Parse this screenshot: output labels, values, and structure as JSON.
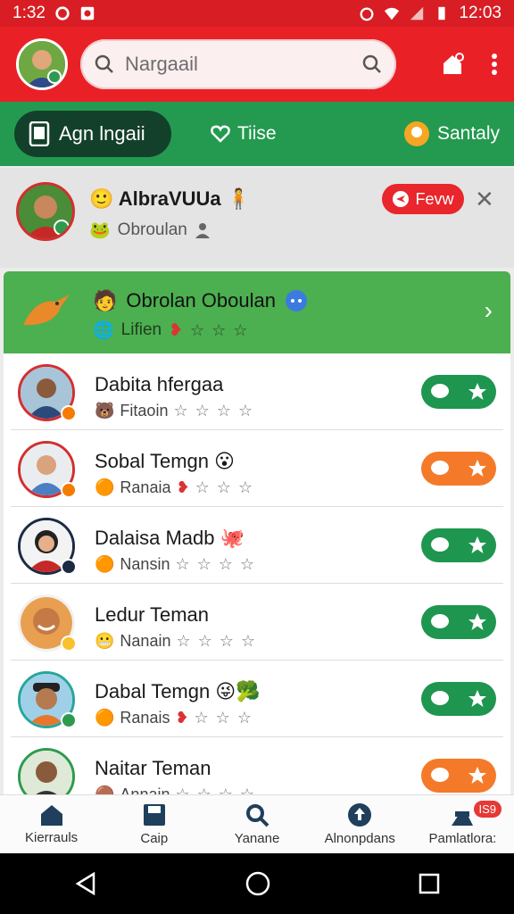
{
  "status_bar": {
    "time_left": "1:32",
    "time_right": "12:03"
  },
  "search": {
    "placeholder": "Nargaail"
  },
  "tabs": [
    {
      "label": "Agn lngaii"
    },
    {
      "label": "Tiise"
    },
    {
      "label": "Santaly"
    }
  ],
  "featured": {
    "name": "AlbraVUUa",
    "sub": "Obroulan",
    "button": "Fevw"
  },
  "highlight": {
    "title": "Obrolan Oboulan",
    "sub": "Lifien"
  },
  "rows": [
    {
      "name": "Dabita hfergaa",
      "sub": "Fitaoin",
      "action": "green"
    },
    {
      "name": "Sobal Temgn",
      "sub": "Ranaia",
      "action": "orange"
    },
    {
      "name": "Dalaisa Madb",
      "sub": "Nansin",
      "action": "green"
    },
    {
      "name": "Ledur Teman",
      "sub": "Nanain",
      "action": "green"
    },
    {
      "name": "Dabal Temgn",
      "sub": "Ranais",
      "action": "green"
    },
    {
      "name": "Naitar Teman",
      "sub": "Annain",
      "action": "orange"
    }
  ],
  "bottom_nav": [
    {
      "label": "Kierrauls",
      "icon": "home-icon"
    },
    {
      "label": "Caip",
      "icon": "save-icon"
    },
    {
      "label": "Yanane",
      "icon": "search-icon"
    },
    {
      "label": "Alnonpdans",
      "icon": "upload-icon"
    },
    {
      "label": "Pamlatlora:",
      "icon": "group-icon",
      "badge": "IS9"
    }
  ],
  "colors": {
    "status_bar": "#d81e24",
    "app_bar": "#ea2027",
    "tab_bar": "#239a4f",
    "highlight": "#4caf50",
    "pill_green": "#1e9650",
    "pill_orange": "#f47a2a"
  }
}
